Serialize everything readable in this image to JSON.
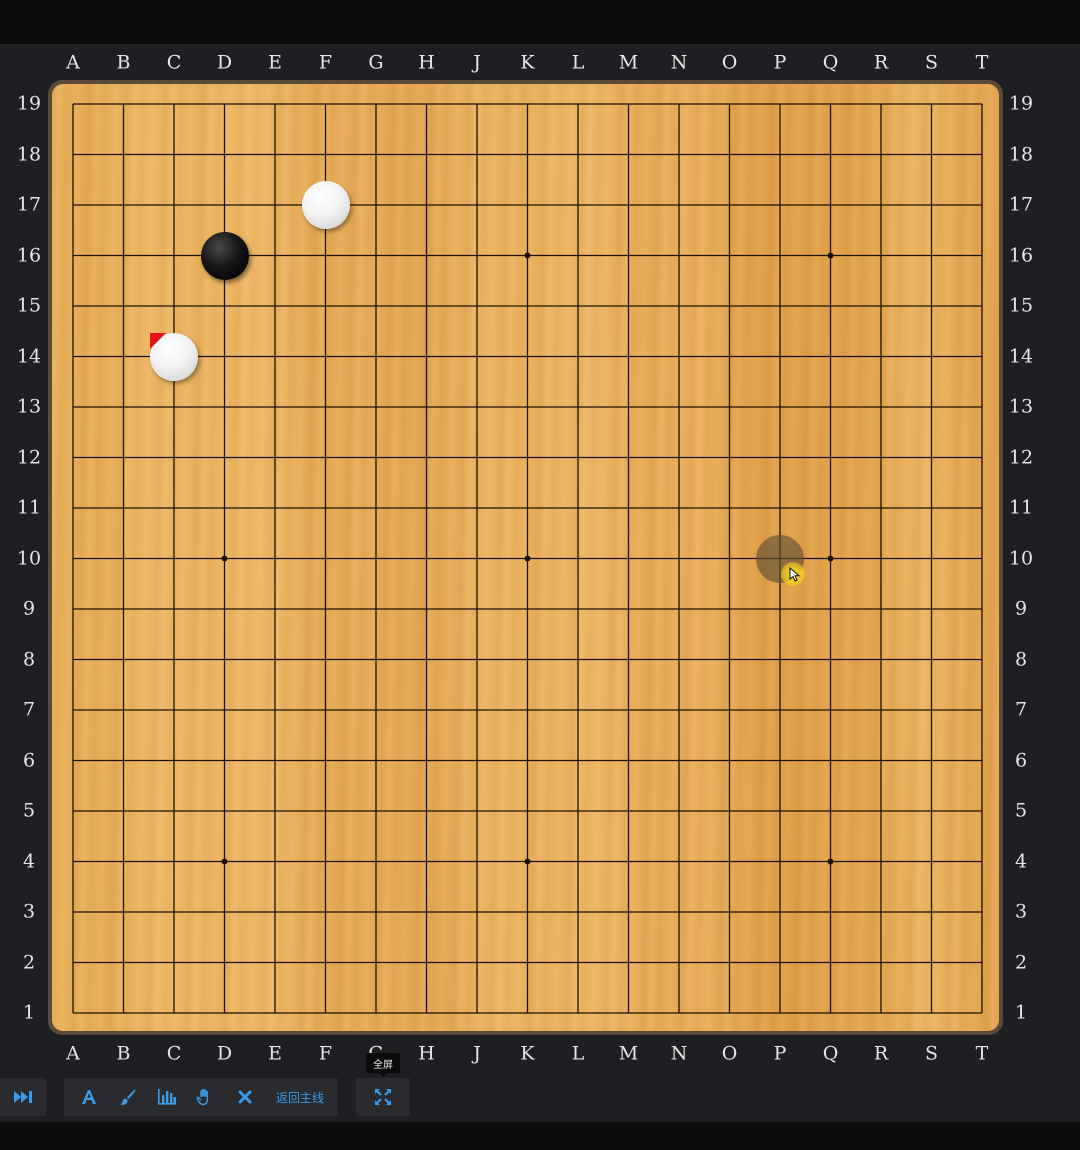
{
  "board": {
    "size": 19,
    "columns": [
      "A",
      "B",
      "C",
      "D",
      "E",
      "F",
      "G",
      "H",
      "J",
      "K",
      "L",
      "M",
      "N",
      "O",
      "P",
      "Q",
      "R",
      "S",
      "T"
    ],
    "rows": [
      19,
      18,
      17,
      16,
      15,
      14,
      13,
      12,
      11,
      10,
      9,
      8,
      7,
      6,
      5,
      4,
      3,
      2,
      1
    ],
    "star_points": [
      "D16",
      "K16",
      "Q16",
      "D10",
      "K10",
      "Q10",
      "D4",
      "K4",
      "Q4"
    ],
    "stones": [
      {
        "color": "white",
        "point": "F17"
      },
      {
        "color": "black",
        "point": "D16"
      },
      {
        "color": "white",
        "point": "C14",
        "last_move": true
      }
    ],
    "hover_point": "P10",
    "colors": {
      "line": "#1a1208",
      "last_move_marker": "#e8131a",
      "label": "#e6e6e6"
    }
  },
  "toolbar": {
    "accent_color": "#3a9be8",
    "buttons": [
      {
        "name": "fast-forward-button",
        "icon": "fast-forward-icon"
      },
      {
        "name": "text-label-button",
        "icon": "letter-a-icon"
      },
      {
        "name": "draw-button",
        "icon": "brush-icon"
      },
      {
        "name": "analysis-chart-button",
        "icon": "bar-chart-icon"
      },
      {
        "name": "pan-hand-button",
        "icon": "hand-icon"
      },
      {
        "name": "clear-marks-button",
        "icon": "close-icon"
      },
      {
        "name": "return-main-line-button",
        "label": "返回主线"
      },
      {
        "name": "fullscreen-button",
        "icon": "fullscreen-arrows-icon",
        "tooltip": "全屏"
      }
    ],
    "return_main_label": "返回主线",
    "fullscreen_tooltip": "全屏"
  }
}
